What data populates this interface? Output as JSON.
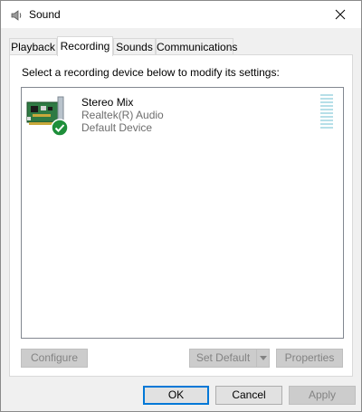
{
  "window": {
    "title": "Sound"
  },
  "tabs": [
    {
      "label": "Playback"
    },
    {
      "label": "Recording"
    },
    {
      "label": "Sounds"
    },
    {
      "label": "Communications"
    }
  ],
  "recording": {
    "instructions": "Select a recording device below to modify its settings:",
    "devices": [
      {
        "name": "Stereo Mix",
        "driver": "Realtek(R) Audio",
        "status": "Default Device"
      }
    ]
  },
  "panel_buttons": {
    "configure": "Configure",
    "set_default": "Set Default",
    "properties": "Properties"
  },
  "dialog_buttons": {
    "ok": "OK",
    "cancel": "Cancel",
    "apply": "Apply"
  },
  "colors": {
    "accent": "#0078d7",
    "check_green": "#1e8f3a",
    "level_meter": "#b6dfe8"
  },
  "icons": {
    "title": "speaker-icon",
    "close": "close-icon",
    "device": "sound-card-icon",
    "default_badge": "checkmark-icon",
    "split": "chevron-down-icon"
  }
}
